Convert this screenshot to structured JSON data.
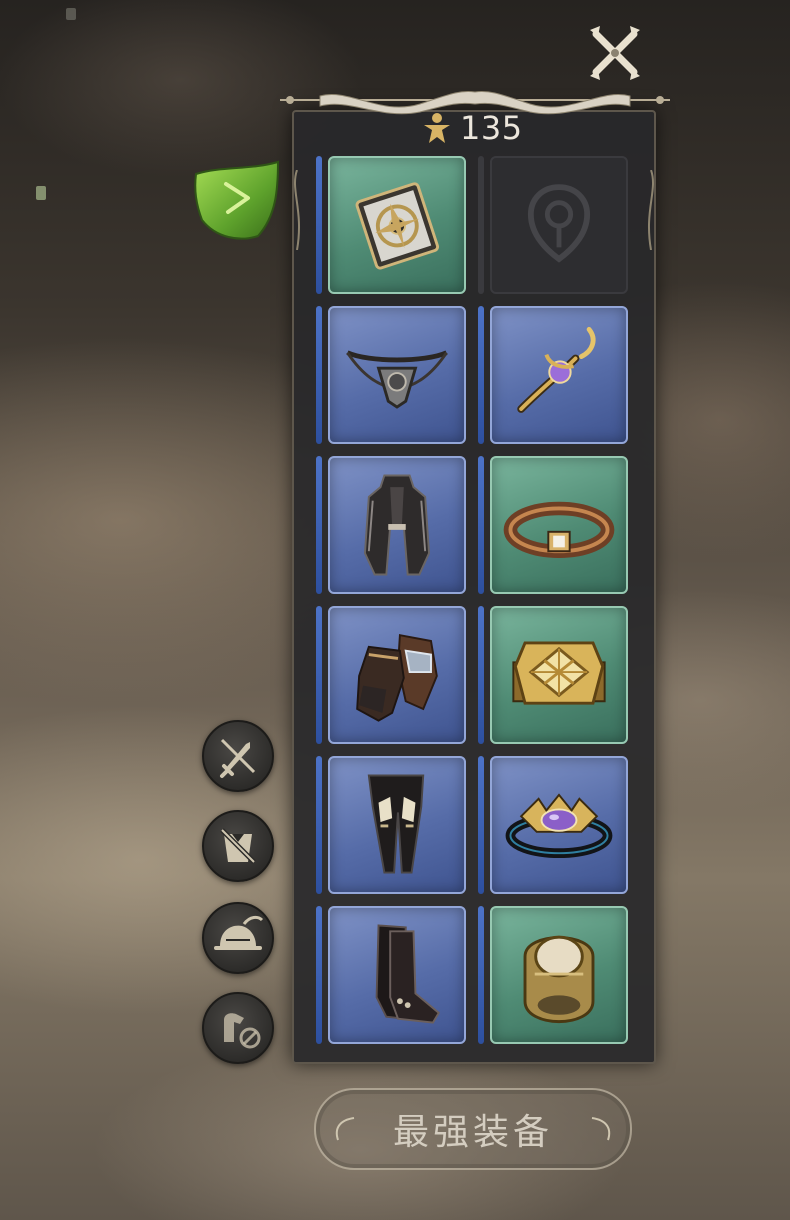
{
  "currency": {
    "icon": "figure-token-icon",
    "value": "135"
  },
  "slots": [
    {
      "name": "slot-relic",
      "rarity": "green",
      "icon": "relic-book-icon"
    },
    {
      "name": "slot-crest-empty",
      "rarity": "empty",
      "icon": "emblem-placeholder-icon"
    },
    {
      "name": "slot-necklace",
      "rarity": "blue",
      "icon": "necklace-icon"
    },
    {
      "name": "slot-earring",
      "rarity": "blue",
      "icon": "earring-icon"
    },
    {
      "name": "slot-armor",
      "rarity": "blue",
      "icon": "armor-coat-icon"
    },
    {
      "name": "slot-bracelet",
      "rarity": "green",
      "icon": "bracelet-icon"
    },
    {
      "name": "slot-gloves",
      "rarity": "blue",
      "icon": "gloves-icon"
    },
    {
      "name": "slot-ring-gold",
      "rarity": "green",
      "icon": "gold-ring-icon"
    },
    {
      "name": "slot-leggings",
      "rarity": "blue",
      "icon": "leggings-icon"
    },
    {
      "name": "slot-ring-purple",
      "rarity": "blue",
      "icon": "purple-ring-icon"
    },
    {
      "name": "slot-boots",
      "rarity": "blue",
      "icon": "boots-icon"
    },
    {
      "name": "slot-ring-signet",
      "rarity": "green",
      "icon": "signet-ring-icon"
    }
  ],
  "side_buttons": [
    {
      "icon": "hide-weapon-icon"
    },
    {
      "icon": "hide-cape-icon"
    },
    {
      "icon": "helmet-icon"
    },
    {
      "icon": "hide-mount-icon"
    }
  ],
  "actions": {
    "best_equipment_label": "最强装备"
  },
  "colors": {
    "green_slot": "#4f8b74",
    "blue_slot": "#566ca8",
    "panel_bg": "#28282a",
    "accent_bar": "#3d62b6"
  }
}
